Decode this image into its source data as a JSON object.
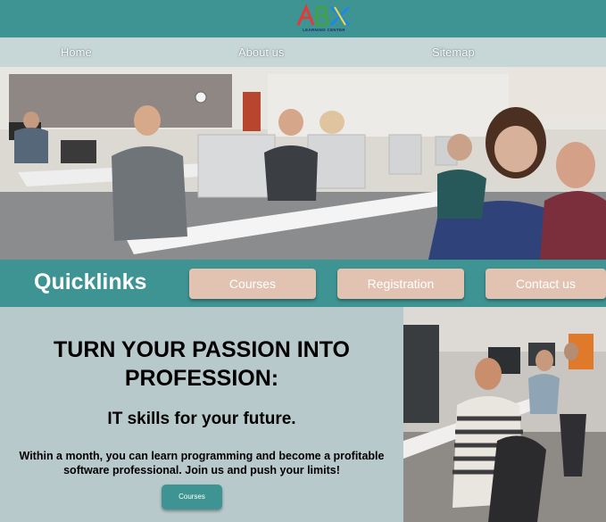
{
  "brand": {
    "logo_text": "LEARNING CENTER"
  },
  "nav": {
    "items": [
      {
        "label": "Home"
      },
      {
        "label": "About us"
      },
      {
        "label": "Sitemap"
      }
    ]
  },
  "quicklinks": {
    "title": "Quicklinks",
    "buttons": [
      {
        "label": "Courses"
      },
      {
        "label": "Registration"
      },
      {
        "label": "Contact us"
      }
    ]
  },
  "promo": {
    "title_line1": "TURN YOUR PASSION INTO",
    "title_line2": "PROFESSION:",
    "subtitle": "IT skills for your future.",
    "body_line1": "Within a month, you can learn programming and become a profitable",
    "body_line2": "software professional. Join us and push your limits!",
    "button_label": "Courses"
  },
  "colors": {
    "teal": "#3e9393",
    "nav_bg": "#c7d6d7",
    "button_peach": "#e2c3b2",
    "promo_bg": "#b8c9cb"
  }
}
